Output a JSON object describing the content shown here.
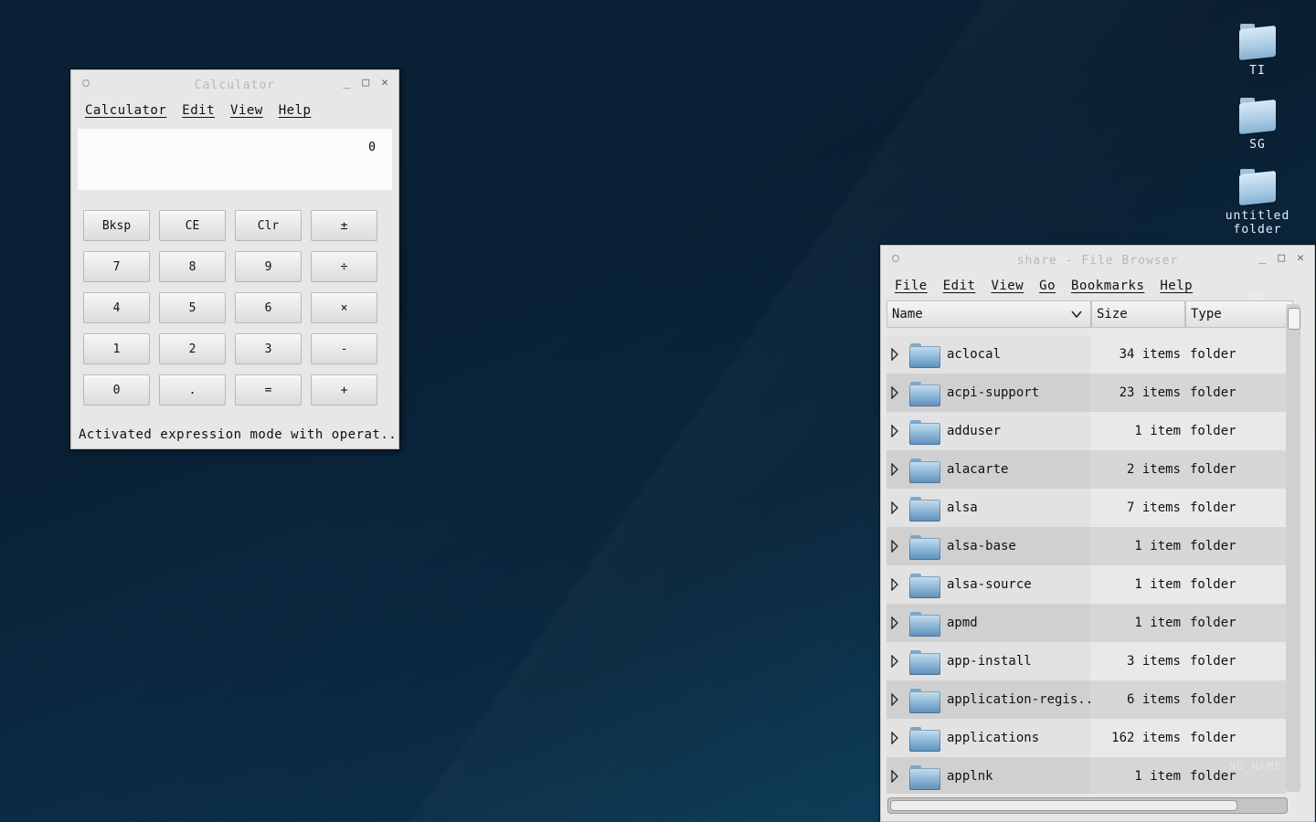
{
  "desktop": {
    "icons": [
      {
        "label": "TI"
      },
      {
        "label": "SG"
      },
      {
        "label": "untitled folder"
      }
    ],
    "ghost_labels": [
      "nm",
      "NO_NAME"
    ]
  },
  "calculator": {
    "title": "Calculator",
    "controls": {
      "minimize": "_",
      "maximize": "□",
      "close": "✕"
    },
    "menu": [
      "Calculator",
      "Edit",
      "View",
      "Help"
    ],
    "display": "0",
    "keys": [
      "Bksp",
      "CE",
      "Clr",
      "±",
      "7",
      "8",
      "9",
      "÷",
      "4",
      "5",
      "6",
      "×",
      "1",
      "2",
      "3",
      "-",
      "0",
      ".",
      "=",
      "+"
    ],
    "status": "Activated expression mode with operat..."
  },
  "file_browser": {
    "title": "share - File Browser",
    "controls": {
      "minimize": "_",
      "maximize": "□",
      "close": "✕"
    },
    "menu": [
      "File",
      "Edit",
      "View",
      "Go",
      "Bookmarks",
      "Help"
    ],
    "columns": [
      "Name",
      "Size",
      "Type"
    ],
    "rows": [
      {
        "name": "aclocal",
        "size": "34 items",
        "type": "folder"
      },
      {
        "name": "acpi-support",
        "size": "23 items",
        "type": "folder"
      },
      {
        "name": "adduser",
        "size": "1 item",
        "type": "folder"
      },
      {
        "name": "alacarte",
        "size": "2 items",
        "type": "folder"
      },
      {
        "name": "alsa",
        "size": "7 items",
        "type": "folder"
      },
      {
        "name": "alsa-base",
        "size": "1 item",
        "type": "folder"
      },
      {
        "name": "alsa-source",
        "size": "1 item",
        "type": "folder"
      },
      {
        "name": "apmd",
        "size": "1 item",
        "type": "folder"
      },
      {
        "name": "app-install",
        "size": "3 items",
        "type": "folder"
      },
      {
        "name": "application-regis...",
        "size": "6 items",
        "type": "folder"
      },
      {
        "name": "applications",
        "size": "162 items",
        "type": "folder"
      },
      {
        "name": "applnk",
        "size": "1 item",
        "type": "folder"
      }
    ]
  }
}
